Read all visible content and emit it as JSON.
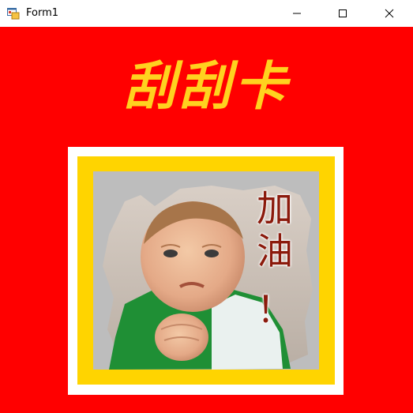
{
  "window": {
    "title": "Form1",
    "icons": {
      "app": "app-form-icon",
      "minimize": "minimize-icon",
      "maximize": "maximize-icon",
      "close": "close-icon"
    }
  },
  "card": {
    "title": "刮刮卡",
    "scratch_text": [
      "加",
      "油",
      "！"
    ],
    "colors": {
      "background": "#ff0000",
      "title": "#ffd21f",
      "outer_frame": "#ffffff",
      "inner_frame": "#ffd400",
      "scratch_cover": "#bdbdbd",
      "text": "#8b1a0c"
    }
  }
}
